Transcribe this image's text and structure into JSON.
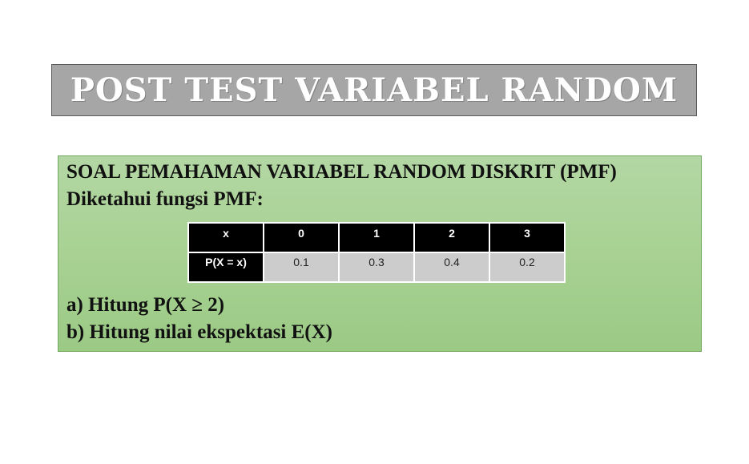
{
  "title": "POST TEST VARIABEL RANDOM",
  "content": {
    "heading": "SOAL PEMAHAMAN VARIABEL RANDOM DISKRIT (PMF)",
    "subheading": "Diketahui fungsi PMF:",
    "table": {
      "header": [
        "x",
        "0",
        "1",
        "2",
        "3"
      ],
      "row": [
        "P(X = x)",
        "0.1",
        "0.3",
        "0.4",
        "0.2"
      ]
    },
    "questions": [
      "a) Hitung P(X ≥ 2)",
      "b) Hitung nilai ekspektasi E(X)"
    ]
  },
  "colors": {
    "title_background": "#a6a6a6",
    "content_background": "#a8d193",
    "table_header": "#000000",
    "table_cell": "#cccccc"
  }
}
